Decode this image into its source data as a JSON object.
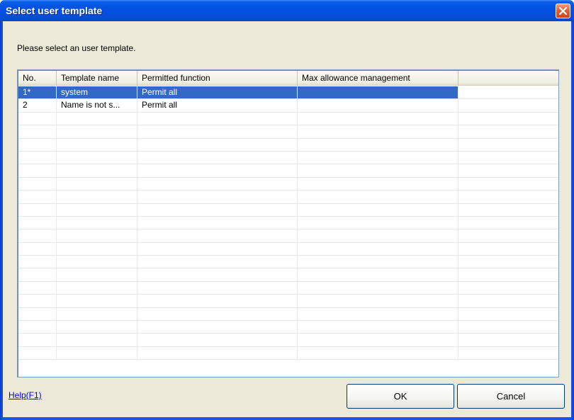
{
  "window": {
    "title": "Select user template"
  },
  "prompt": "Please select an user template.",
  "table": {
    "columns": [
      "No.",
      "Template name",
      "Permitted function",
      "Max allowance management",
      ""
    ],
    "rows": [
      {
        "no": "1*",
        "name": "system",
        "func": "Permit all",
        "max": "",
        "extra": "",
        "selected": true
      },
      {
        "no": "2",
        "name": "Name is not s...",
        "func": "Permit all",
        "max": "",
        "extra": "",
        "selected": false
      }
    ],
    "empty_rows": 19
  },
  "help_link": "Help(F1)",
  "buttons": {
    "ok": "OK",
    "cancel": "Cancel"
  },
  "colors": {
    "selection": "#316ac5",
    "titlebar": "#0353e3",
    "dialog_bg": "#ece9d8"
  },
  "icons": {
    "close": "close-icon"
  }
}
